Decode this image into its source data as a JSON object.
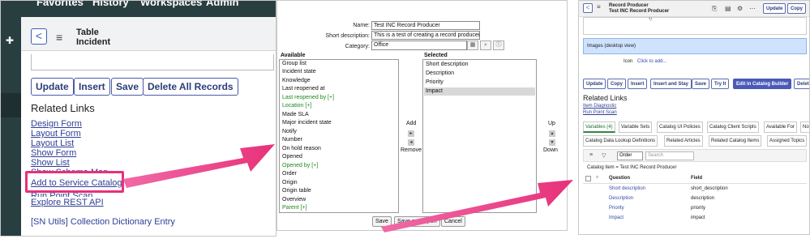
{
  "panel1": {
    "top_nav": [
      "Favorites",
      "History",
      "Workspaces",
      "Admin"
    ],
    "header": {
      "title_line1": "Table",
      "title_line2": "Incident"
    },
    "buttons": [
      "Update",
      "Insert",
      "Save",
      "Delete All Records"
    ],
    "related_links_title": "Related Links",
    "links": [
      "Design Form",
      "Layout Form",
      "Layout List",
      "Show Form",
      "Show List",
      "Show Schema Map",
      "Add to Service Catalog",
      "Run Point Scan",
      "Explore REST API",
      "[SN Utils] Collection Dictionary Entry"
    ],
    "highlighted_link": "Add to Service Catalog",
    "accent_color": "#e8317a"
  },
  "panel2": {
    "fields": [
      {
        "label": "Name:",
        "value": "Test INC Record Producer"
      },
      {
        "label": "Short description:",
        "value": "This is a test of creating a record producer"
      },
      {
        "label": "Category:",
        "value": "Office"
      }
    ],
    "available_title": "Available",
    "selected_title": "Selected",
    "available": [
      {
        "text": "Group list",
        "green": false
      },
      {
        "text": "Incident state",
        "green": false
      },
      {
        "text": "Knowledge",
        "green": false
      },
      {
        "text": "Last reopened at",
        "green": false
      },
      {
        "text": "Last reopened by [+]",
        "green": true
      },
      {
        "text": "Location [+]",
        "green": true
      },
      {
        "text": "Made SLA",
        "green": false
      },
      {
        "text": "Major incident state",
        "green": false
      },
      {
        "text": "Notify",
        "green": false
      },
      {
        "text": "Number",
        "green": false
      },
      {
        "text": "On hold reason",
        "green": false
      },
      {
        "text": "Opened",
        "green": false
      },
      {
        "text": "Opened by [+]",
        "green": true
      },
      {
        "text": "Order",
        "green": false
      },
      {
        "text": "Origin",
        "green": false
      },
      {
        "text": "Origin table",
        "green": false
      },
      {
        "text": "Overview",
        "green": false
      },
      {
        "text": "Parent [+]",
        "green": true
      }
    ],
    "selected": [
      "Short description",
      "Description",
      "Priority",
      "Impact"
    ],
    "selected_highlight": "Impact",
    "add_label": "Add",
    "remove_label": "Remove",
    "up_label": "Up",
    "down_label": "Down",
    "buttons": [
      "Save",
      "Save and Open",
      "Cancel"
    ]
  },
  "panel3": {
    "header": {
      "line1": "Record Producer",
      "line2": "Test INC Record Producer"
    },
    "header_buttons": [
      "Update",
      "Copy"
    ],
    "code_snippet": "*/",
    "images_section": "Images (desktop view)",
    "icon_label": "Icon",
    "icon_link": "Click to add...",
    "buttons": [
      "Update",
      "Copy",
      "Insert",
      "Insert and Stay",
      "Save",
      "Try It",
      "Edit in Catalog Builder",
      "Delete"
    ],
    "related_links_title": "Related Links",
    "links": [
      "Item Diagnostic",
      "Run Point Scan"
    ],
    "tabs_row1": [
      "Variables (4)",
      "Variable Sets",
      "Catalog UI Policies",
      "Catalog Client Scripts",
      "Available For",
      "Not"
    ],
    "tabs_row2": [
      "Catalog Data Lookup Definitions",
      "Related Articles",
      "Related Catalog Items",
      "Assigned Topics"
    ],
    "filter_select": "Order",
    "search_placeholder": "Search",
    "breadcrumb": "Catalog item = Test INC Record Producer",
    "columns": [
      "Question",
      "Field"
    ],
    "rows": [
      {
        "question": "Short description",
        "field": "short_description"
      },
      {
        "question": "Description",
        "field": "description"
      },
      {
        "question": "Priority",
        "field": "priority"
      },
      {
        "question": "Impact",
        "field": "impact"
      }
    ]
  }
}
